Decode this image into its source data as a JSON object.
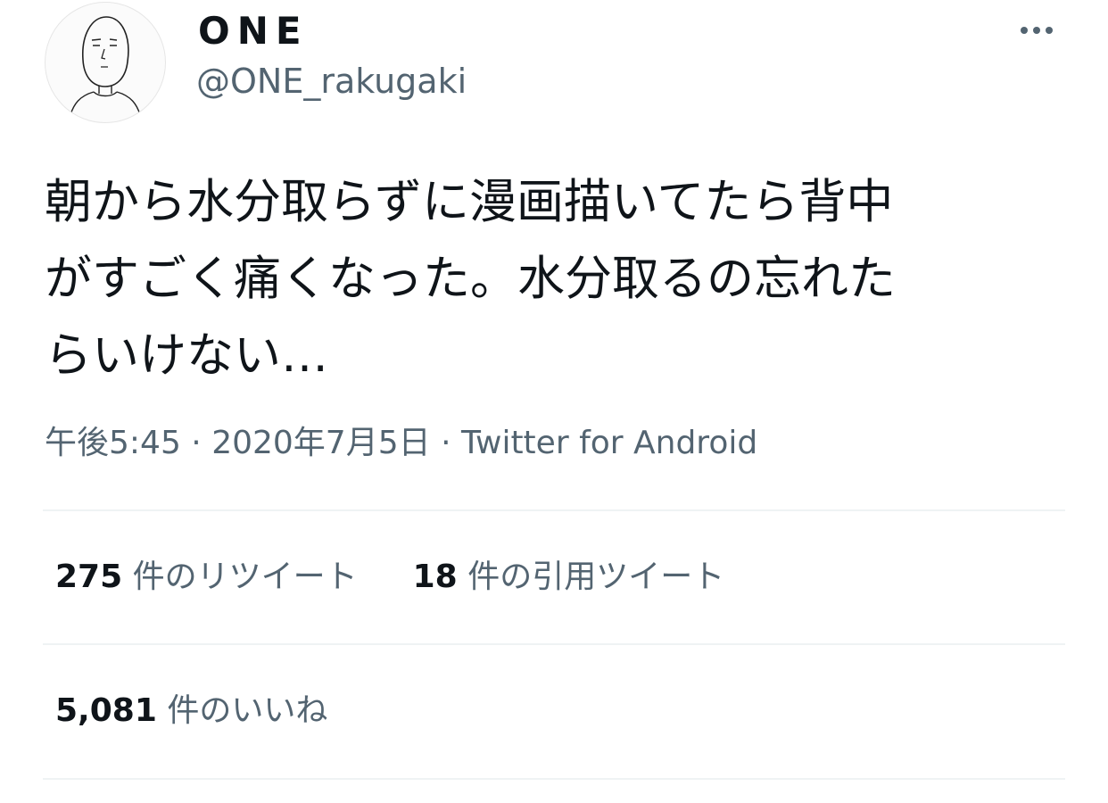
{
  "author": {
    "display_name": "ONE",
    "handle": "@ONE_rakugaki",
    "avatar_icon": "doodle-face-avatar-icon"
  },
  "more_icon": "more-horizontal-icon",
  "tweet": {
    "text": "朝から水分取らずに漫画描いてたら背中\nがすごく痛くなった。水分取るの忘れた\nらいけない…"
  },
  "meta": {
    "time": "午後5:45",
    "separator": " · ",
    "date": "2020年7月5日",
    "source": "Twitter for Android"
  },
  "stats": {
    "retweets": {
      "count": "275",
      "label": "件のリツイート"
    },
    "quotes": {
      "count": "18",
      "label": "件の引用ツイート"
    },
    "likes": {
      "count": "5,081",
      "label": "件のいいね"
    }
  },
  "colors": {
    "text_primary": "#0f1419",
    "text_secondary": "#536471",
    "divider": "#eff3f4"
  }
}
